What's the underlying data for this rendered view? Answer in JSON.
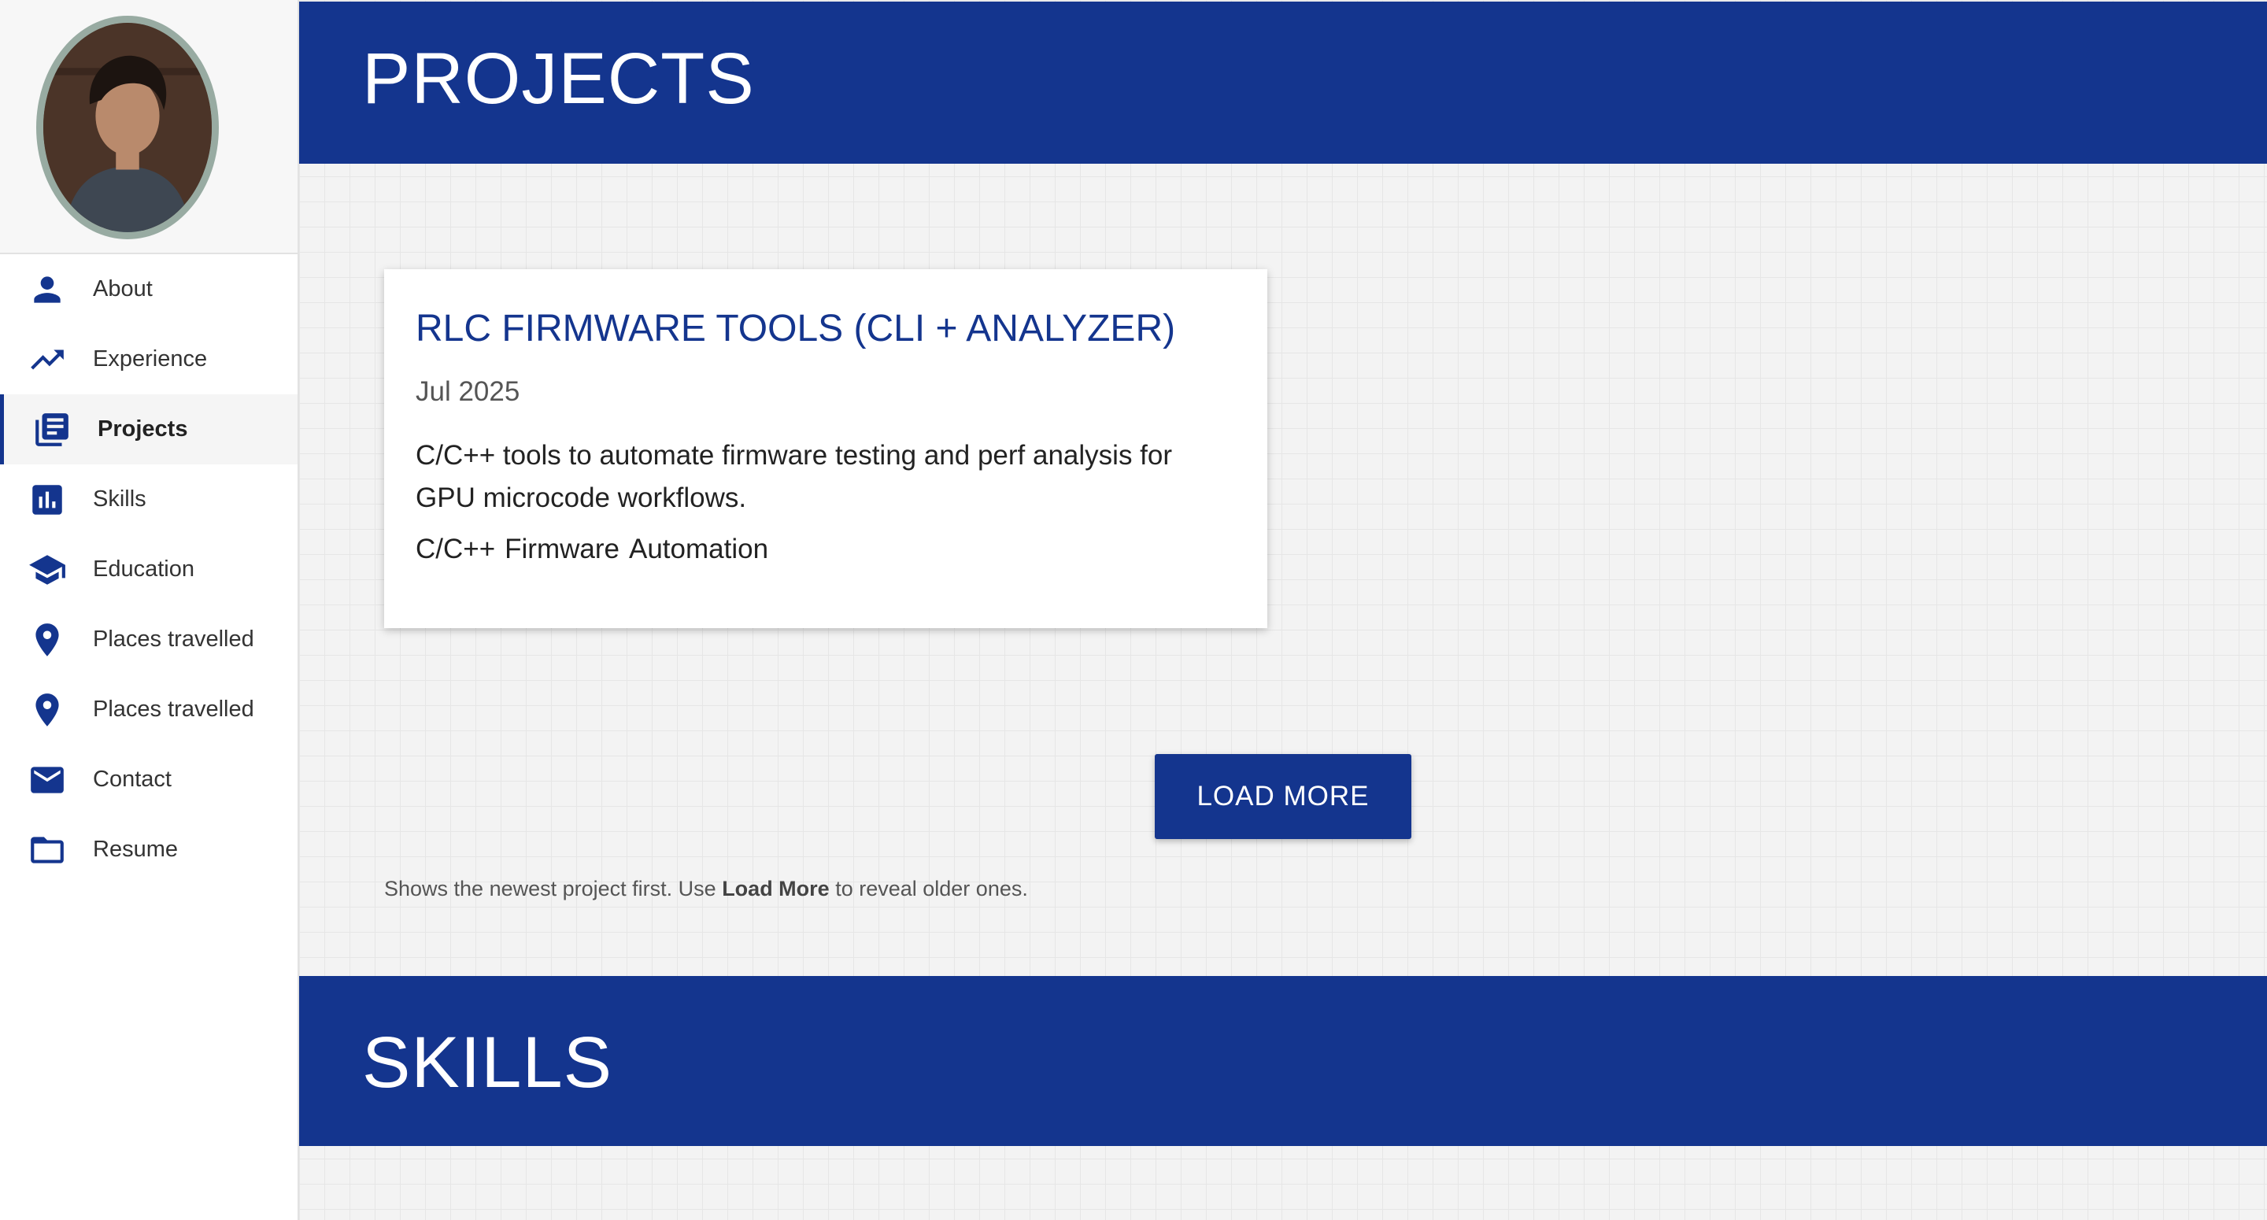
{
  "sidebar": {
    "avatar_alt": "Profile photo",
    "items": [
      {
        "label": "About",
        "icon": "person-icon"
      },
      {
        "label": "Experience",
        "icon": "trending-up-icon"
      },
      {
        "label": "Projects",
        "icon": "library-books-icon",
        "active": true
      },
      {
        "label": "Skills",
        "icon": "bar-chart-icon"
      },
      {
        "label": "Education",
        "icon": "graduation-cap-icon"
      },
      {
        "label": "Places travelled",
        "icon": "map-pin-icon"
      },
      {
        "label": "Places travelled",
        "icon": "map-pin-icon"
      },
      {
        "label": "Contact",
        "icon": "mail-icon"
      },
      {
        "label": "Resume",
        "icon": "folder-icon"
      }
    ]
  },
  "projects": {
    "heading": "PROJECTS",
    "cards": [
      {
        "title": "RLC FIRMWARE TOOLS (CLI + ANALYZER)",
        "date": "Jul 2025",
        "description": "C/C++ tools to automate firmware testing and perf analysis for GPU microcode workflows.",
        "tags": [
          "C/C++",
          "Firmware",
          "Automation"
        ]
      }
    ],
    "load_more_label": "LOAD MORE",
    "hint_prefix": "Shows the newest project first. Use ",
    "hint_bold": "Load More",
    "hint_suffix": " to reveal older ones."
  },
  "skills": {
    "heading": "SKILLS"
  },
  "colors": {
    "brand": "#14358e",
    "background": "#f3f3f3",
    "avatar_border": "#98aba2"
  }
}
